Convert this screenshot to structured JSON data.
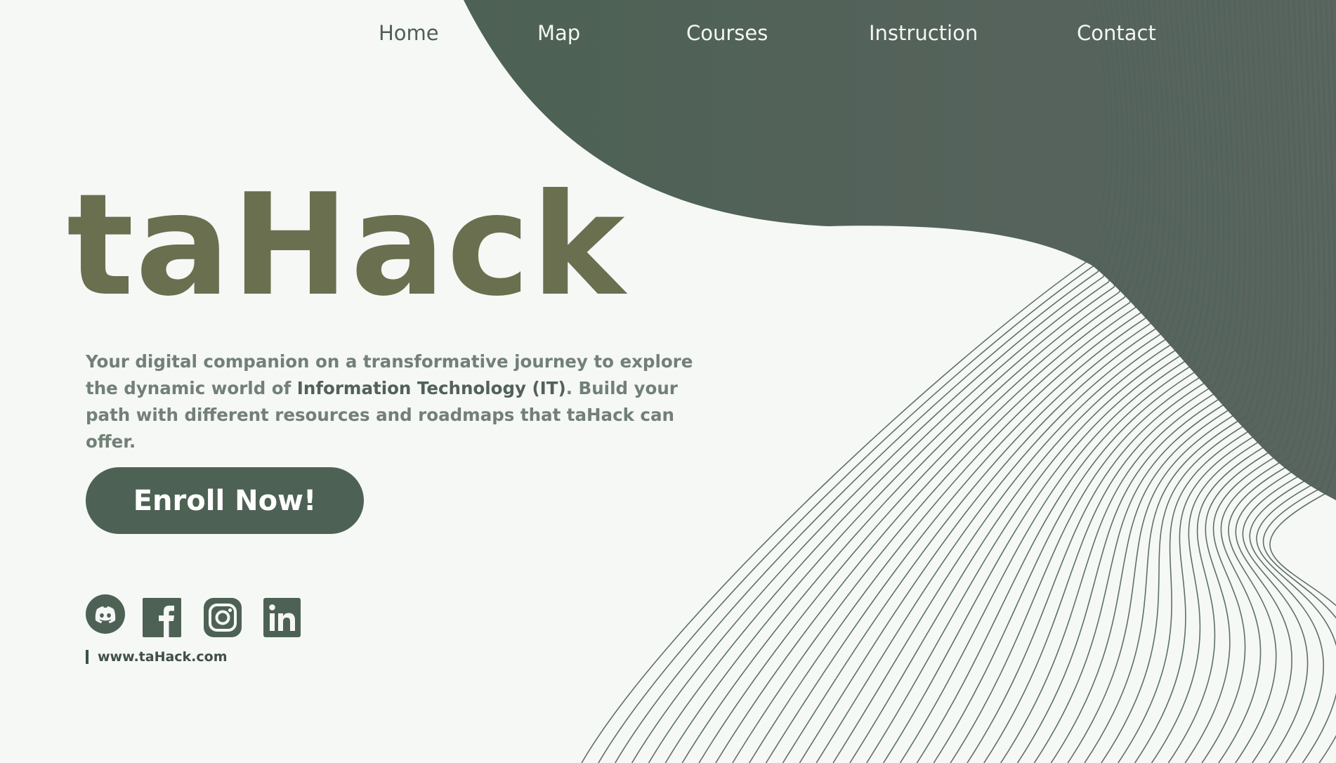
{
  "nav": {
    "items": [
      "Home",
      "Map",
      "Courses",
      "Instruction",
      "Contact"
    ]
  },
  "hero": {
    "logo": "taHack",
    "tagline_part1": "Your digital companion on a transformative journey to explore the dynamic world of ",
    "tagline_emphasis": "Information Technology (IT)",
    "tagline_part2": ". Build your path with different resources and roadmaps that taHack can offer.",
    "cta_label": "Enroll Now!"
  },
  "social": {
    "icons": [
      "discord-icon",
      "facebook-icon",
      "instagram-icon",
      "linkedin-icon"
    ],
    "website": "www.taHack.com"
  },
  "colors": {
    "background": "#f5f8f5",
    "blob": "#526356",
    "logo": "#6a6f50",
    "accent_button": "#4e6155",
    "line_art": "#4f6357"
  }
}
